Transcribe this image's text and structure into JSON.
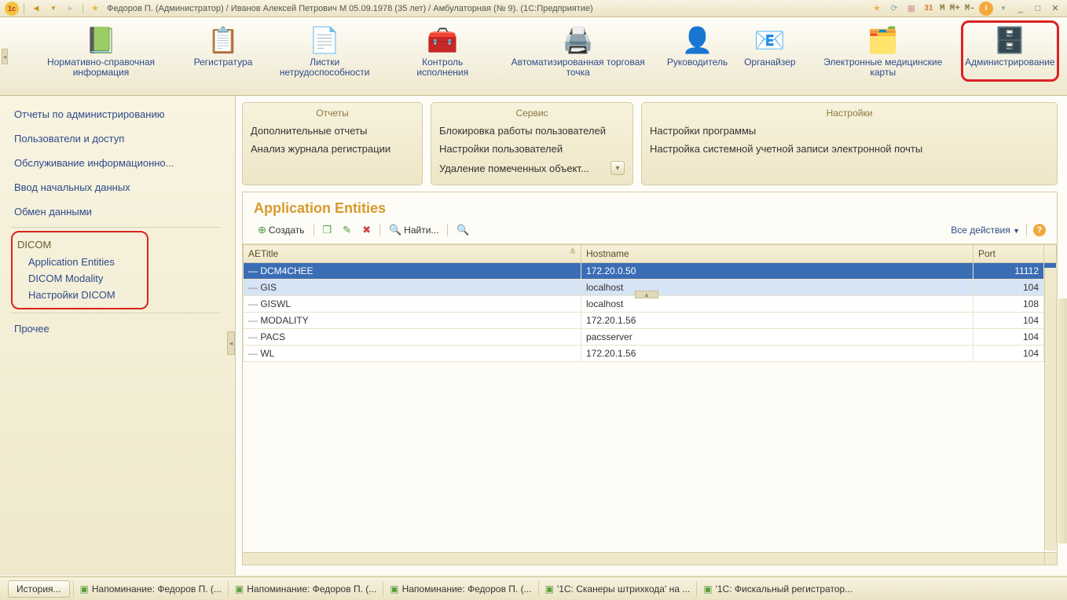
{
  "titlebar": {
    "app_icon": "1c",
    "title": "Федоров П. (Администратор) / Иванов Алексей Петрович М 05.09.1978 (35 лет) / Амбулаторная (№ 9).  (1С:Предприятие)",
    "mem_m": "M",
    "mem_mplus": "M+",
    "mem_mminus": "M-"
  },
  "nav": [
    {
      "id": "ref-info",
      "label": "Нормативно-справочная информация"
    },
    {
      "id": "registry",
      "label": "Регистратура"
    },
    {
      "id": "sick-leave",
      "label": "Листки нетрудоспособности"
    },
    {
      "id": "exec-control",
      "label": "Контроль исполнения"
    },
    {
      "id": "pos",
      "label": "Автоматизированная торговая точка"
    },
    {
      "id": "manager",
      "label": "Руководитель"
    },
    {
      "id": "organizer",
      "label": "Органайзер"
    },
    {
      "id": "emr",
      "label": "Электронные медицинские карты"
    },
    {
      "id": "admin",
      "label": "Администрирование",
      "highlighted": true
    }
  ],
  "sidebar": {
    "items_top": [
      "Отчеты по администрированию",
      "Пользователи и доступ",
      "Обслуживание информационно...",
      "Ввод начальных данных",
      "Обмен данными"
    ],
    "dicom_title": "DICOM",
    "dicom_items": [
      "Application Entities",
      "DICOM Modality",
      "Настройки DICOM"
    ],
    "other": "Прочее"
  },
  "panels": {
    "reports": {
      "title": "Отчеты",
      "items": [
        "Дополнительные отчеты",
        "Анализ журнала регистрации"
      ]
    },
    "service": {
      "title": "Сервис",
      "items": [
        "Блокировка работы пользователей",
        "Настройки пользователей",
        "Удаление помеченных объект..."
      ]
    },
    "settings": {
      "title": "Настройки",
      "items": [
        "Настройки программы",
        "Настройка системной учетной записи электронной почты"
      ]
    }
  },
  "list": {
    "title": "Application Entities",
    "create": "Создать",
    "find": "Найти...",
    "all_actions": "Все действия",
    "columns": {
      "aetitle": "AETitle",
      "hostname": "Hostname",
      "port": "Port"
    },
    "rows": [
      {
        "aetitle": "DCM4CHEE",
        "hostname": "172.20.0.50",
        "port": "11112",
        "selected": true
      },
      {
        "aetitle": "GIS",
        "hostname": "localhost",
        "port": "104",
        "after_sel": true
      },
      {
        "aetitle": "GISWL",
        "hostname": "localhost",
        "port": "108"
      },
      {
        "aetitle": "MODALITY",
        "hostname": "172.20.1.56",
        "port": "104"
      },
      {
        "aetitle": "PACS",
        "hostname": "pacsserver",
        "port": "104"
      },
      {
        "aetitle": "WL",
        "hostname": "172.20.1.56",
        "port": "104"
      }
    ]
  },
  "statusbar": {
    "history": "История...",
    "tasks": [
      "Напоминание: Федоров П. (...",
      "Напоминание: Федоров П. (...",
      "Напоминание: Федоров П. (...",
      "'1С: Сканеры штрихкода' на ...",
      "'1С: Фискальный регистратор..."
    ]
  }
}
